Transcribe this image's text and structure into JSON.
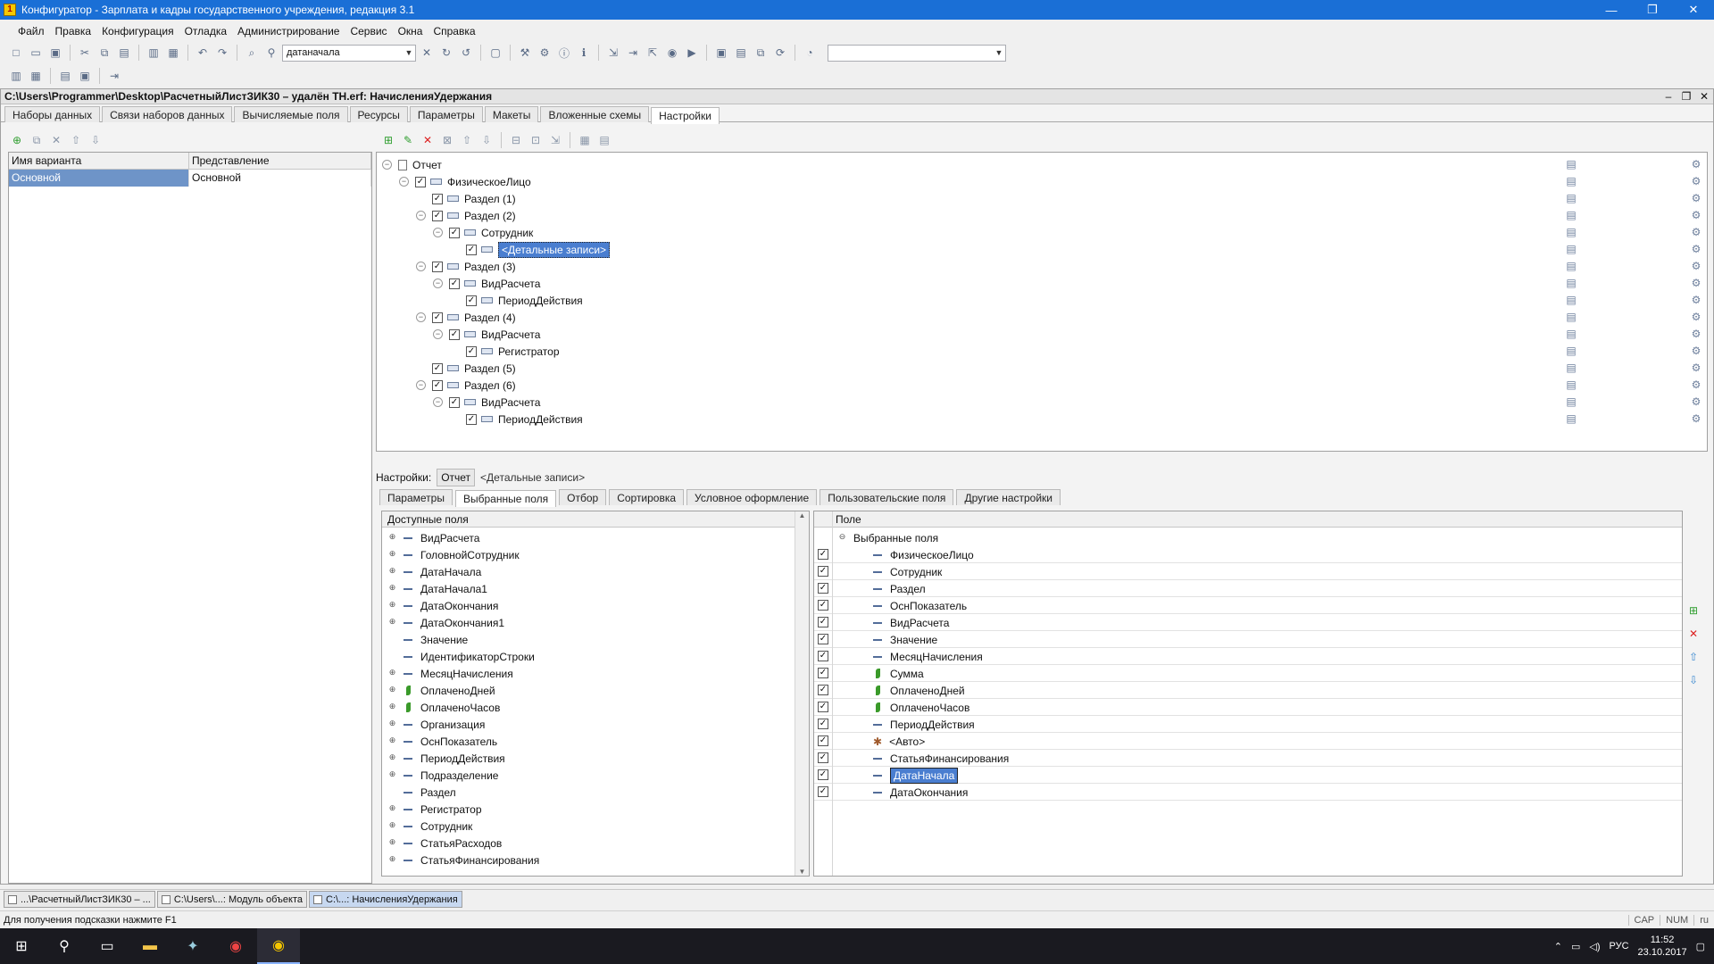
{
  "app": {
    "title": "Конфигуратор - Зарплата и кадры государственного учреждения, редакция 3.1",
    "controls": [
      "—",
      "❐",
      "✕"
    ]
  },
  "menu": [
    "Файл",
    "Правка",
    "Конфигурация",
    "Отладка",
    "Администрирование",
    "Сервис",
    "Окна",
    "Справка"
  ],
  "toolbar": {
    "search_value": "датаначала"
  },
  "document": {
    "title": "C:\\Users\\Programmer\\Desktop\\РасчетныйЛистЗИК30 – удалён ТН.erf: НачисленияУдержания",
    "tabs": [
      "Наборы данных",
      "Связи наборов данных",
      "Вычисляемые поля",
      "Ресурсы",
      "Параметры",
      "Макеты",
      "Вложенные схемы",
      "Настройки"
    ],
    "active_tab": "Настройки"
  },
  "variants": {
    "columns": [
      "Имя варианта",
      "Представление"
    ],
    "rows": [
      [
        "Основной",
        "Основной"
      ]
    ]
  },
  "structure_tree": [
    {
      "label": "Отчет",
      "level": 0,
      "expander": true,
      "checkbox": false,
      "icon": "doc"
    },
    {
      "label": "ФизическоеЛицо",
      "level": 1,
      "expander": true,
      "checkbox": true,
      "icon": "group"
    },
    {
      "label": "Раздел (1)",
      "level": 2,
      "expander": false,
      "checkbox": true,
      "icon": "group"
    },
    {
      "label": "Раздел (2)",
      "level": 2,
      "expander": true,
      "checkbox": true,
      "icon": "group"
    },
    {
      "label": "Сотрудник",
      "level": 3,
      "expander": true,
      "checkbox": true,
      "icon": "group"
    },
    {
      "label": "<Детальные записи>",
      "level": 4,
      "expander": false,
      "checkbox": true,
      "icon": "group",
      "selected": true
    },
    {
      "label": "Раздел (3)",
      "level": 2,
      "expander": true,
      "checkbox": true,
      "icon": "group"
    },
    {
      "label": "ВидРасчета",
      "level": 3,
      "expander": true,
      "checkbox": true,
      "icon": "group"
    },
    {
      "label": "ПериодДействия",
      "level": 4,
      "expander": false,
      "checkbox": true,
      "icon": "group"
    },
    {
      "label": "Раздел (4)",
      "level": 2,
      "expander": true,
      "checkbox": true,
      "icon": "group"
    },
    {
      "label": "ВидРасчета",
      "level": 3,
      "expander": true,
      "checkbox": true,
      "icon": "group"
    },
    {
      "label": "Регистратор",
      "level": 4,
      "expander": false,
      "checkbox": true,
      "icon": "group"
    },
    {
      "label": "Раздел (5)",
      "level": 2,
      "expander": false,
      "checkbox": true,
      "icon": "group"
    },
    {
      "label": "Раздел (6)",
      "level": 2,
      "expander": true,
      "checkbox": true,
      "icon": "group"
    },
    {
      "label": "ВидРасчета",
      "level": 3,
      "expander": true,
      "checkbox": true,
      "icon": "group"
    },
    {
      "label": "ПериодДействия",
      "level": 4,
      "expander": false,
      "checkbox": true,
      "icon": "group"
    }
  ],
  "settings_row": {
    "label": "Настройки:",
    "button": "Отчет",
    "context": "<Детальные записи>"
  },
  "settings_tabs": [
    "Параметры",
    "Выбранные поля",
    "Отбор",
    "Сортировка",
    "Условное оформление",
    "Пользовательские поля",
    "Другие настройки"
  ],
  "active_settings_tab": "Выбранные поля",
  "available_fields": {
    "header": "Доступные поля",
    "items": [
      {
        "label": "ВидРасчета",
        "expander": true,
        "icon": "dash"
      },
      {
        "label": "ГоловнойСотрудник",
        "expander": true,
        "icon": "dash"
      },
      {
        "label": "ДатаНачала",
        "expander": true,
        "icon": "dash"
      },
      {
        "label": "ДатаНачала1",
        "expander": true,
        "icon": "dash"
      },
      {
        "label": "ДатаОкончания",
        "expander": true,
        "icon": "dash"
      },
      {
        "label": "ДатаОкончания1",
        "expander": true,
        "icon": "dash"
      },
      {
        "label": "Значение",
        "expander": false,
        "icon": "dash"
      },
      {
        "label": "ИдентификаторСтроки",
        "expander": false,
        "icon": "dash"
      },
      {
        "label": "МесяцНачисления",
        "expander": true,
        "icon": "dash"
      },
      {
        "label": "ОплаченоДней",
        "expander": true,
        "icon": "leaf"
      },
      {
        "label": "ОплаченоЧасов",
        "expander": true,
        "icon": "leaf"
      },
      {
        "label": "Организация",
        "expander": true,
        "icon": "dash"
      },
      {
        "label": "ОснПоказатель",
        "expander": true,
        "icon": "dash"
      },
      {
        "label": "ПериодДействия",
        "expander": true,
        "icon": "dash"
      },
      {
        "label": "Подразделение",
        "expander": true,
        "icon": "dash"
      },
      {
        "label": "Раздел",
        "expander": false,
        "icon": "dash"
      },
      {
        "label": "Регистратор",
        "expander": true,
        "icon": "dash"
      },
      {
        "label": "Сотрудник",
        "expander": true,
        "icon": "dash"
      },
      {
        "label": "СтатьяРасходов",
        "expander": true,
        "icon": "dash"
      },
      {
        "label": "СтатьяФинансирования",
        "expander": true,
        "icon": "dash"
      }
    ]
  },
  "selected_fields": {
    "header": "Поле",
    "root": "Выбранные поля",
    "items": [
      {
        "label": "ФизическоеЛицо",
        "icon": "dash"
      },
      {
        "label": "Сотрудник",
        "icon": "dash"
      },
      {
        "label": "Раздел",
        "icon": "dash"
      },
      {
        "label": "ОснПоказатель",
        "icon": "dash"
      },
      {
        "label": "ВидРасчета",
        "icon": "dash"
      },
      {
        "label": "Значение",
        "icon": "dash"
      },
      {
        "label": "МесяцНачисления",
        "icon": "dash"
      },
      {
        "label": "Сумма",
        "icon": "leaf"
      },
      {
        "label": "ОплаченоДней",
        "icon": "leaf"
      },
      {
        "label": "ОплаченоЧасов",
        "icon": "leaf"
      },
      {
        "label": "ПериодДействия",
        "icon": "dash"
      },
      {
        "label": "<Авто>",
        "icon": "auto"
      },
      {
        "label": "СтатьяФинансирования",
        "icon": "dash"
      },
      {
        "label": "ДатаНачала",
        "icon": "dash",
        "selected": true
      },
      {
        "label": "ДатаОкончания",
        "icon": "dash"
      }
    ]
  },
  "window_tabs": [
    {
      "label": "...\\РасчетныйЛистЗИК30 – ...",
      "active": false
    },
    {
      "label": "C:\\Users\\...: Модуль объекта",
      "active": false
    },
    {
      "label": "C:\\...: НачисленияУдержания",
      "active": true
    }
  ],
  "status": {
    "hint": "Для получения подсказки нажмите F1",
    "indicators": [
      "CAP",
      "NUM",
      "ru"
    ]
  },
  "taskbar": {
    "lang": "РУС",
    "time": "11:52",
    "date": "23.10.2017"
  },
  "colors": {
    "titlebar": "#1a6fd6",
    "selection": "#4a7ed0",
    "grid_selection": "#6e94c8"
  }
}
